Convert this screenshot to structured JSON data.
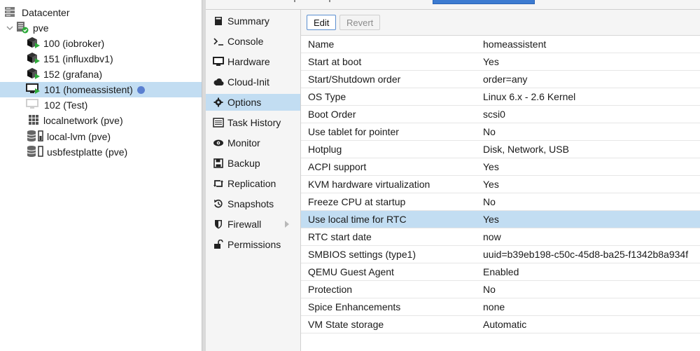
{
  "tree": {
    "root": {
      "label": "Datacenter",
      "icon": "server-rack-icon"
    },
    "node": {
      "label": "pve",
      "icon": "node-online-icon"
    },
    "items": [
      {
        "label": "100 (iobroker)",
        "icon": "container-running-icon"
      },
      {
        "label": "151 (influxdbv1)",
        "icon": "container-running-icon"
      },
      {
        "label": "152 (grafana)",
        "icon": "container-running-icon"
      },
      {
        "label": "101 (homeassistent)",
        "icon": "vm-running-icon",
        "selected": true,
        "status_dot": true
      },
      {
        "label": "102 (Test)",
        "icon": "vm-stopped-icon"
      },
      {
        "label": "localnetwork (pve)",
        "icon": "network-grid-icon"
      },
      {
        "label": "local-lvm (pve)",
        "icon": "storage-icon"
      },
      {
        "label": "usbfestplatte (pve)",
        "icon": "storage-icon"
      }
    ]
  },
  "nav": {
    "items": [
      {
        "label": "Summary",
        "icon": "book-icon"
      },
      {
        "label": "Console",
        "icon": "terminal-icon"
      },
      {
        "label": "Hardware",
        "icon": "monitor-icon"
      },
      {
        "label": "Cloud-Init",
        "icon": "cloud-icon"
      },
      {
        "label": "Options",
        "icon": "gear-icon",
        "active": true
      },
      {
        "label": "Task History",
        "icon": "list-icon"
      },
      {
        "label": "Monitor",
        "icon": "eye-icon"
      },
      {
        "label": "Backup",
        "icon": "floppy-icon"
      },
      {
        "label": "Replication",
        "icon": "retweet-icon"
      },
      {
        "label": "Snapshots",
        "icon": "history-icon"
      },
      {
        "label": "Firewall",
        "icon": "shield-icon",
        "has_submenu": true
      },
      {
        "label": "Permissions",
        "icon": "unlock-icon"
      }
    ]
  },
  "toolbar": {
    "edit_label": "Edit",
    "revert_label": "Revert"
  },
  "options": [
    {
      "key": "Name",
      "value": "homeassistent"
    },
    {
      "key": "Start at boot",
      "value": "Yes"
    },
    {
      "key": "Start/Shutdown order",
      "value": "order=any"
    },
    {
      "key": "OS Type",
      "value": "Linux 6.x - 2.6 Kernel"
    },
    {
      "key": "Boot Order",
      "value": "scsi0"
    },
    {
      "key": "Use tablet for pointer",
      "value": "No"
    },
    {
      "key": "Hotplug",
      "value": "Disk, Network, USB"
    },
    {
      "key": "ACPI support",
      "value": "Yes"
    },
    {
      "key": "KVM hardware virtualization",
      "value": "Yes"
    },
    {
      "key": "Freeze CPU at startup",
      "value": "No"
    },
    {
      "key": "Use local time for RTC",
      "value": "Yes",
      "selected": true
    },
    {
      "key": "RTC start date",
      "value": "now"
    },
    {
      "key": "SMBIOS settings (type1)",
      "value": "uuid=b39eb198-c50c-45d8-ba25-f1342b8a934f"
    },
    {
      "key": "QEMU Guest Agent",
      "value": "Enabled"
    },
    {
      "key": "Protection",
      "value": "No"
    },
    {
      "key": "Spice Enhancements",
      "value": "none"
    },
    {
      "key": "VM State storage",
      "value": "Automatic"
    }
  ],
  "colors": {
    "selection": "#c2ddf2",
    "running": "#2eaa3a",
    "status_dot": "#5a7fd0"
  }
}
